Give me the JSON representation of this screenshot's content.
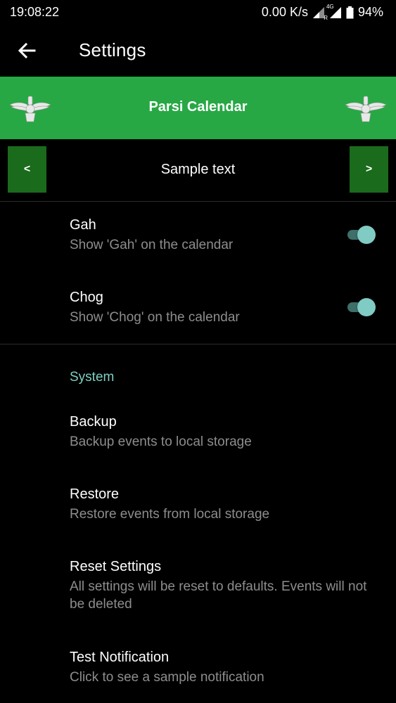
{
  "status_bar": {
    "time": "19:08:22",
    "net_speed": "0.00 K/s",
    "roaming_label": "R",
    "network_label": "4G",
    "battery": "94%"
  },
  "app_bar": {
    "title": "Settings",
    "back_icon": "arrow-back-icon"
  },
  "banner": {
    "title": "Parsi Calendar",
    "emblem_icon": "faravahar-icon",
    "background": "#27a844"
  },
  "sample_nav": {
    "prev_label": "<",
    "next_label": ">",
    "sample_text": "Sample text",
    "button_color": "#1a6b1c"
  },
  "preferences": [
    {
      "title": "Gah",
      "summary": "Show 'Gah' on the calendar",
      "switch_on": true
    },
    {
      "title": "Chog",
      "summary": "Show 'Chog' on the calendar",
      "switch_on": true
    }
  ],
  "system_section": {
    "title": "System",
    "title_color": "#7ecec2",
    "items": [
      {
        "title": "Backup",
        "summary": "Backup events to local storage"
      },
      {
        "title": "Restore",
        "summary": "Restore events from local storage"
      },
      {
        "title": "Reset Settings",
        "summary": "All settings will be reset to defaults. Events will not be deleted"
      },
      {
        "title": "Test Notification",
        "summary": "Click to see a sample notification"
      }
    ]
  },
  "colors": {
    "accent": "#80cbc4",
    "switch_track": "#3e6f69",
    "background": "#000000",
    "summary_text": "#8d8d8d"
  }
}
